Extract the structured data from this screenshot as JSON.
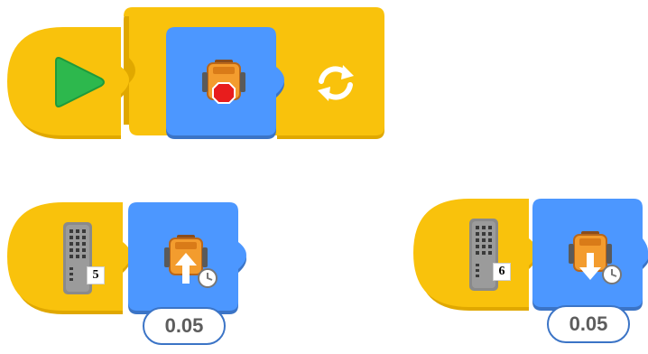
{
  "colors": {
    "trigger_yellow": "#f9c20c",
    "yellow_shadow": "#e0a800",
    "motion_blue": "#4c97ff",
    "blue_shadow": "#3b74c6",
    "play_green": "#2db84d",
    "robot_orange": "#f39c2e",
    "stop_red": "#e81d1d"
  },
  "scripts": [
    {
      "hat": {
        "icon": "green-flag-play-icon"
      },
      "loop": {
        "icon": "forever-loop-icon"
      },
      "action": {
        "icon": "robot-stop-icon"
      }
    },
    {
      "hat": {
        "icon": "remote-control-icon",
        "channel": "5"
      },
      "action": {
        "icon": "robot-forward-icon",
        "value": "0.05"
      }
    },
    {
      "hat": {
        "icon": "remote-control-icon",
        "channel": "6"
      },
      "action": {
        "icon": "robot-backward-icon",
        "value": "0.05"
      }
    }
  ]
}
